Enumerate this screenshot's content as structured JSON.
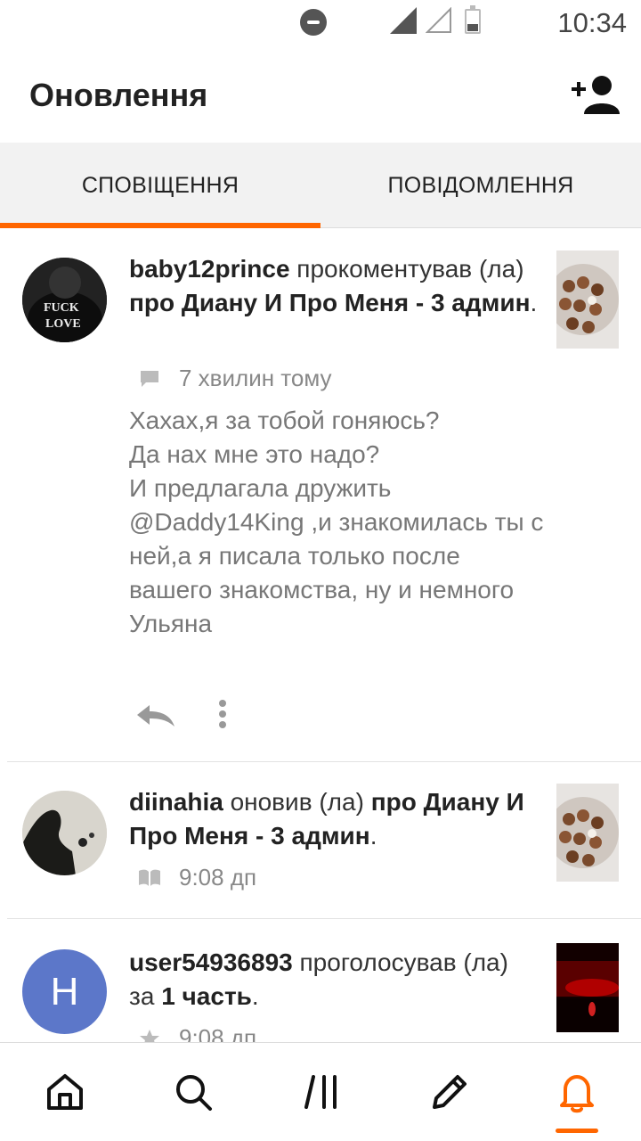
{
  "status_bar": {
    "time": "10:34"
  },
  "header": {
    "title": "Оновлення",
    "add_user_icon": "add-user-icon"
  },
  "tabs": [
    {
      "label": "СПОВІЩЕННЯ",
      "active": true
    },
    {
      "label": "ПОВІДОМЛЕННЯ",
      "active": false
    }
  ],
  "colors": {
    "accent": "#ff6600",
    "avatar_letter_bg": "#5c77c9"
  },
  "notifications": [
    {
      "user": "baby12prince",
      "action": " прокоментував (ла) ",
      "target": "про Диану И Про Меня - 3 админ",
      "suffix": ".",
      "meta_icon": "comment-icon",
      "time": "7 хвилин тому",
      "comment": "Хахах,я за тобой гоняюсь?\nДа нах мне это надо?\nИ предлагала дружить @Daddy14King ,и знакомилась ты с ней,а я писала только после вашего знакомства, ну и немного Ульяна",
      "avatar_text": "FUCK LOVE"
    },
    {
      "user": "diinahia",
      "action": " оновив (ла) ",
      "target": "про Диану И Про Меня - 3 админ",
      "suffix": ".",
      "meta_icon": "book-icon",
      "time": "9:08 дп"
    },
    {
      "user": "user54936893",
      "action": " проголосував (ла) за ",
      "target": "1 часть",
      "suffix": ".",
      "meta_icon": "star-icon",
      "time": "9:08 дп",
      "avatar_letter": "H"
    }
  ],
  "bottom_nav": [
    {
      "name": "home",
      "icon": "home-icon"
    },
    {
      "name": "search",
      "icon": "search-icon"
    },
    {
      "name": "library",
      "icon": "library-icon"
    },
    {
      "name": "write",
      "icon": "pencil-icon"
    },
    {
      "name": "notifications",
      "icon": "bell-icon",
      "active": true
    }
  ]
}
